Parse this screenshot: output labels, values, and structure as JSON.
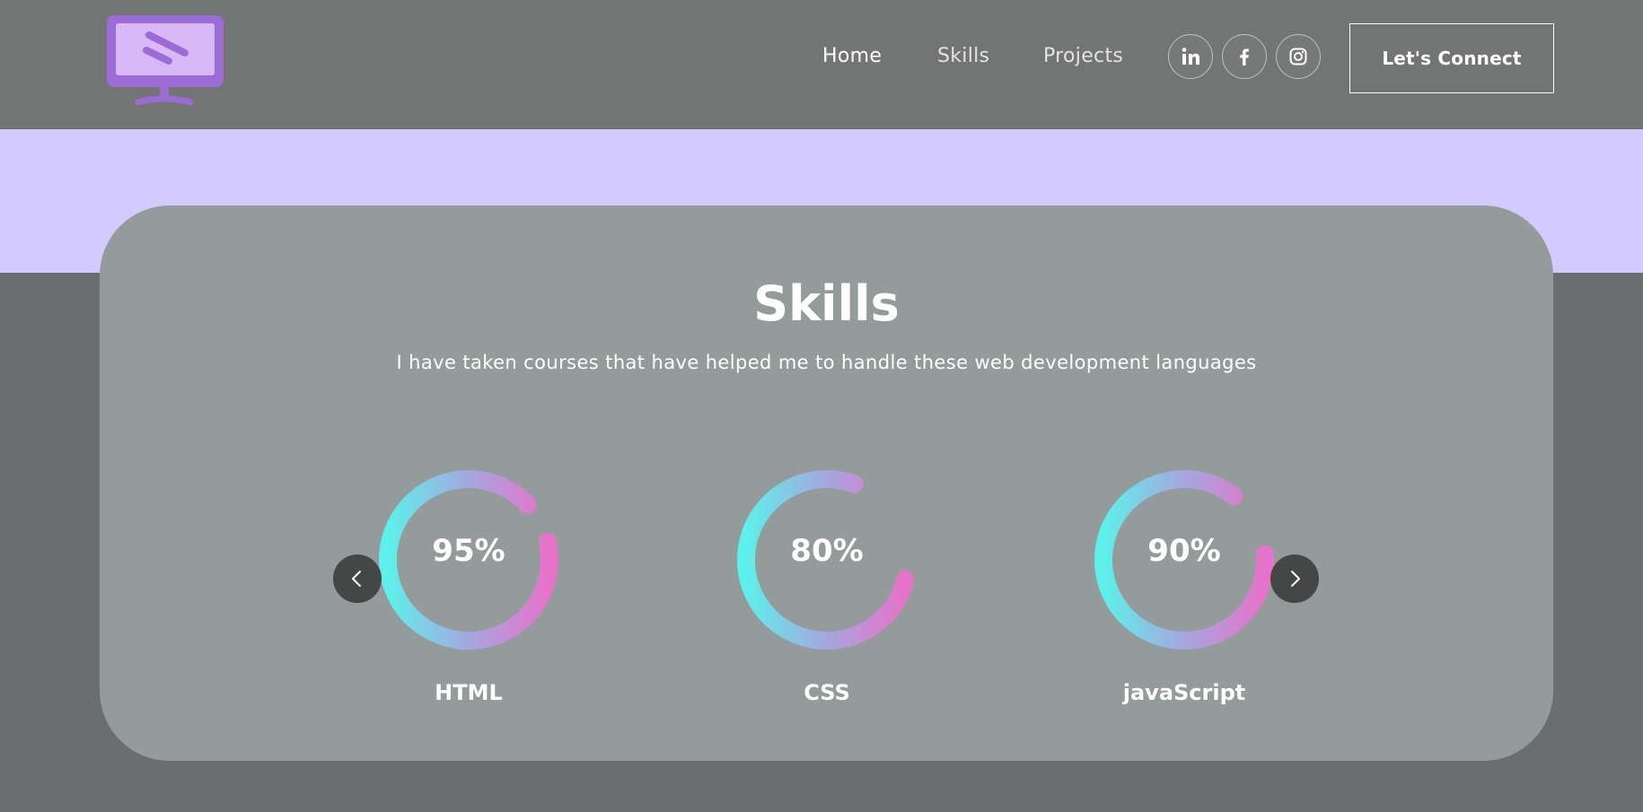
{
  "nav": {
    "links": [
      {
        "label": "Home"
      },
      {
        "label": "Skills"
      },
      {
        "label": "Projects"
      }
    ],
    "social_icons": [
      "linkedin-icon",
      "facebook-icon",
      "instagram-icon"
    ],
    "connect_label": "Let's Connect"
  },
  "logo": {
    "icon": "monitor-logo-icon",
    "color": "#9b6bd6"
  },
  "banner": {
    "color": "#d3cbff"
  },
  "skills": {
    "title": "Skills",
    "subtitle": "I have taken courses that have helped me to handle these web development languages",
    "items": [
      {
        "percent_label": "95%",
        "name": "HTML",
        "level": 0.95
      },
      {
        "percent_label": "80%",
        "name": "CSS",
        "level": 0.8
      },
      {
        "percent_label": "90%",
        "name": "javaScript",
        "level": 0.9
      }
    ],
    "prev_icon": "chevron-left-icon",
    "next_icon": "chevron-right-icon"
  },
  "colors": {
    "ring_start": "#5ef0ea",
    "ring_mid": "#a6a6e0",
    "ring_end": "#e772c9",
    "card": "#939c9a",
    "page": "#6b6e6e"
  }
}
